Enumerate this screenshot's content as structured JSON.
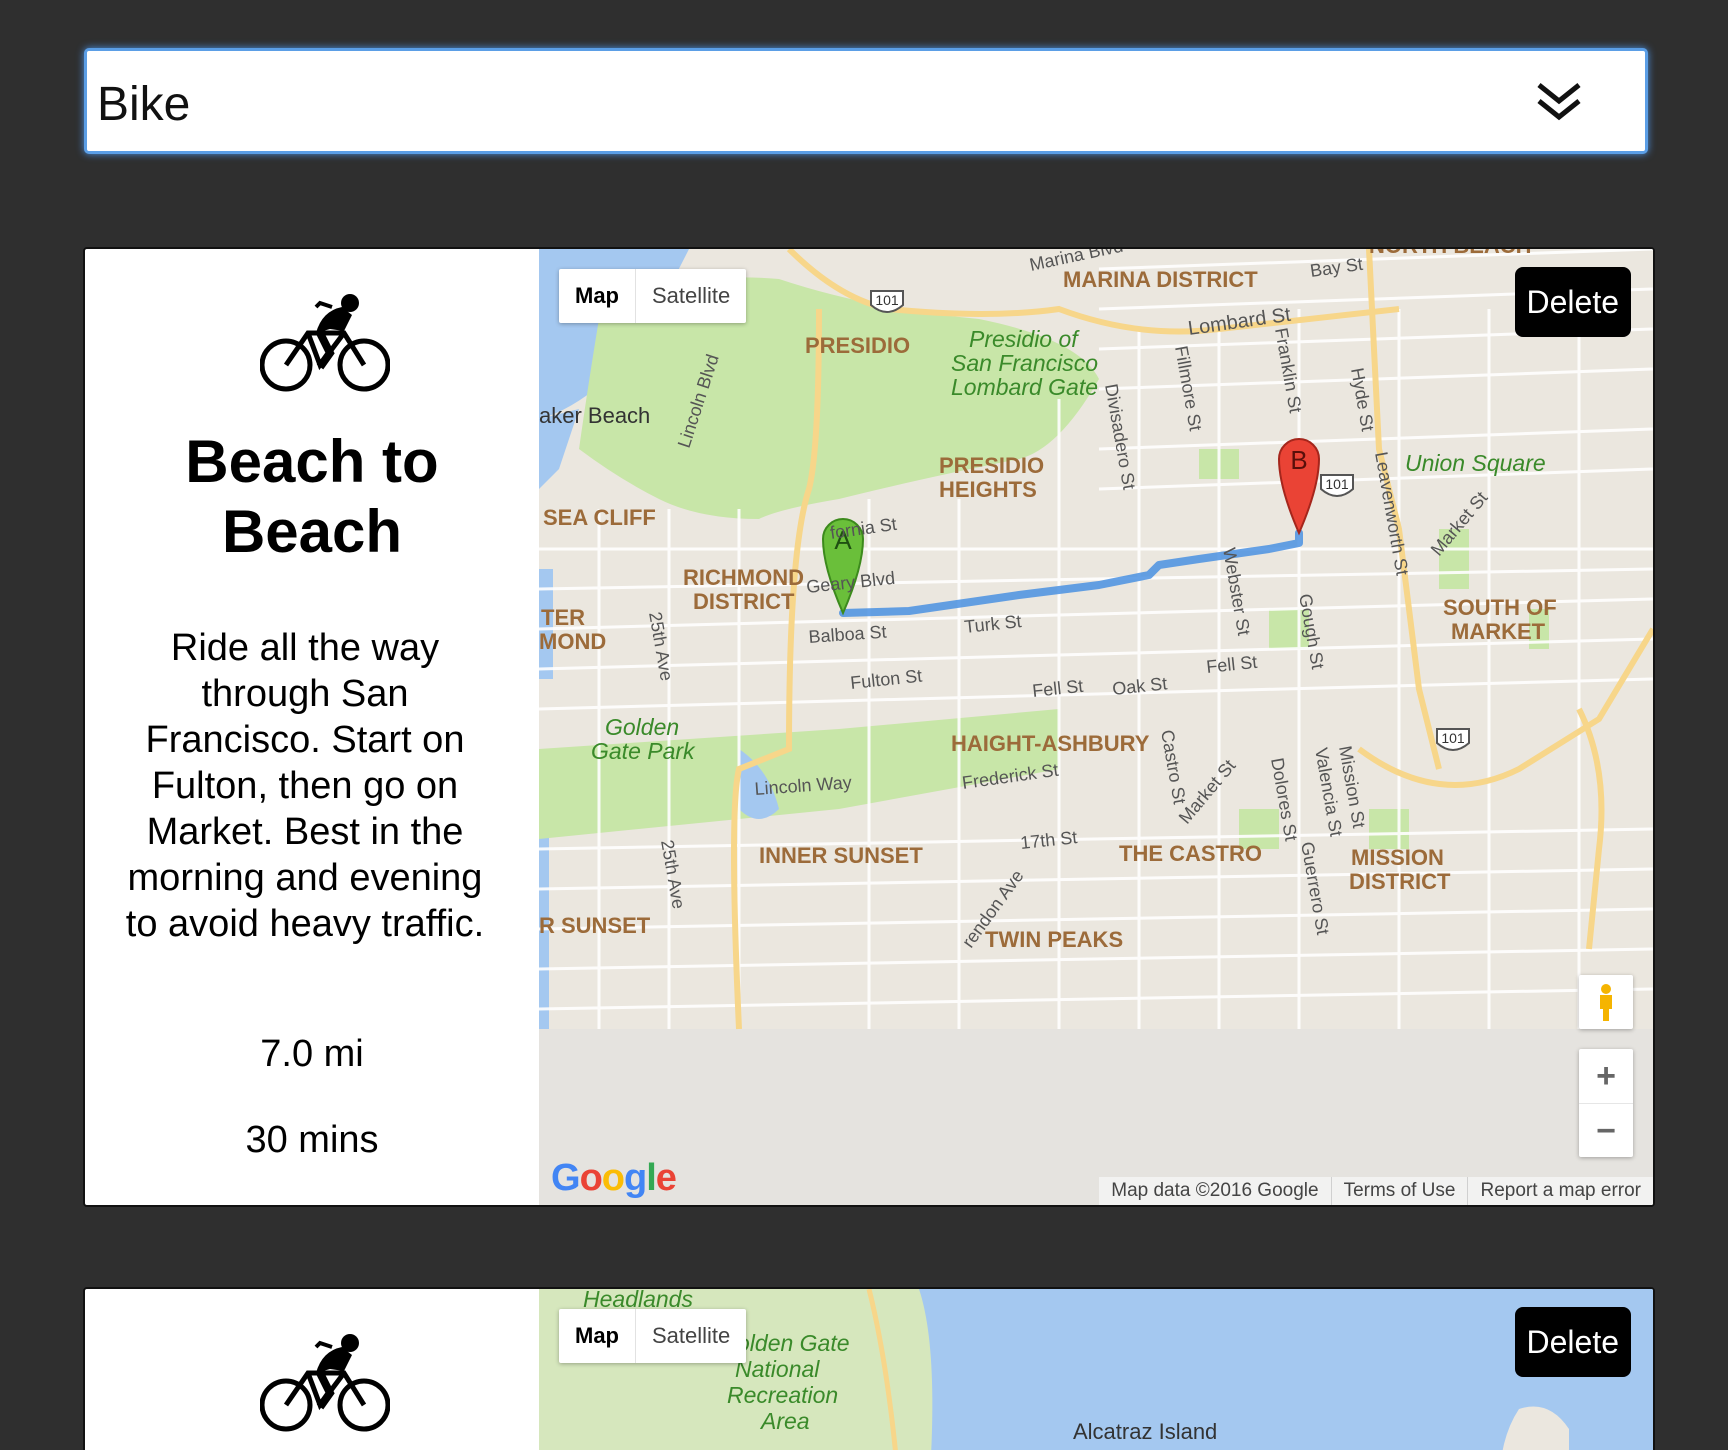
{
  "mode_select": {
    "value": "Bike",
    "chevron_icon": "double-chevron-down-icon"
  },
  "routes": [
    {
      "activity_icon": "bicycle-rider-icon",
      "title": "Beach to Beach",
      "description": "Ride all the way through San Francisco. Start on Fulton, then go on Market. Best in the morning and evening to avoid heavy traffic.",
      "distance": "7.0 mi",
      "duration": "30 mins",
      "delete_label": "Delete",
      "map": {
        "type_buttons": [
          "Map",
          "Satellite"
        ],
        "selected_type": "Map",
        "marker_a": "A",
        "marker_b": "B",
        "route_color": "#4a90e2",
        "zoom_in": "+",
        "zoom_out": "−",
        "logo": "Google",
        "attribution": [
          "Map data ©2016 Google",
          "Terms of Use",
          "Report a map error"
        ],
        "labels": {
          "marina_blvd": "Marina Blvd",
          "marina_district": "MARINA DISTRICT",
          "north_beach": "NORTH BEACH",
          "bay_st": "Bay St",
          "presidio": "PRESIDIO",
          "presidio_gate_1": "Presidio of",
          "presidio_gate_2": "San Francisco",
          "presidio_gate_3": "Lombard Gate",
          "lombard_st": "Lombard St",
          "baker_beach": "aker Beach",
          "lincoln_blvd": "Lincoln Blvd",
          "divisadero_st": "Divisadero St",
          "fillmore_st": "Fillmore St",
          "franklin_st": "Franklin St",
          "hyde_st": "Hyde St",
          "presidio_heights_1": "PRESIDIO",
          "presidio_heights_2": "HEIGHTS",
          "sea_cliff": "SEA CLIFF",
          "california_st": "fornia St",
          "union_square": "Union Square",
          "leavenworth_st": "Leavenworth St",
          "richmond_1": "RICHMOND",
          "richmond_2": "DISTRICT",
          "geary_blvd": "Geary Blvd",
          "webster_st": "Webster St",
          "gough_st": "Gough St",
          "outer_richmond_1": "TER",
          "outer_richmond_2": "MOND",
          "balboa_st": "Balboa St",
          "turk_st": "Turk St",
          "ave_25th": "25th Ave",
          "fulton_st": "Fulton St",
          "fell_st": "Fell St",
          "oak_st": "Oak St",
          "south_of_market_1": "SOUTH OF",
          "south_of_market_2": "MARKET",
          "market_st": "Market St",
          "golden_gate_park_1": "Golden",
          "golden_gate_park_2": "Gate Park",
          "haight_ashbury": "HAIGHT-ASHBURY",
          "castro_st": "Castro St",
          "lincoln_way": "Lincoln Way",
          "frederick_st": "Frederick St",
          "dolores_st": "Dolores St",
          "valencia_st": "Valencia St",
          "mission_st": "Mission St",
          "inner_sunset": "INNER SUNSET",
          "st_17th": "17th St",
          "the_castro": "THE CASTRO",
          "mission_district_1": "MISSION",
          "mission_district_2": "DISTRICT",
          "guerrero_st": "Guerrero St",
          "sunset": "R SUNSET",
          "twin_peaks": "TWIN PEAKS",
          "portola": "rendon Ave",
          "shield_101": "101"
        }
      }
    },
    {
      "activity_icon": "bicycle-rider-icon",
      "delete_label": "Delete",
      "map": {
        "type_buttons": [
          "Map",
          "Satellite"
        ],
        "selected_type": "Map",
        "labels": {
          "headlands": "Headlands",
          "ggnra_1": "olden Gate",
          "ggnra_2": "National",
          "ggnra_3": "Recreation",
          "ggnra_4": "Area",
          "alcatraz": "Alcatraz Island"
        }
      }
    }
  ]
}
